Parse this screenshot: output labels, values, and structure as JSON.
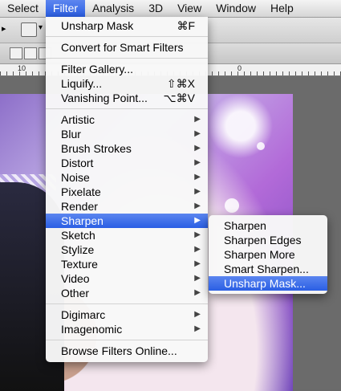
{
  "menubar": {
    "items": [
      {
        "label": "Select",
        "active": false
      },
      {
        "label": "Filter",
        "active": true
      },
      {
        "label": "Analysis",
        "active": false
      },
      {
        "label": "3D",
        "active": false
      },
      {
        "label": "View",
        "active": false
      },
      {
        "label": "Window",
        "active": false
      },
      {
        "label": "Help",
        "active": false
      }
    ]
  },
  "ruler": {
    "labels": [
      "10",
      "0"
    ]
  },
  "filter_menu": {
    "unsharp_mask": {
      "label": "Unsharp Mask",
      "shortcut": "⌘F"
    },
    "convert_smart": "Convert for Smart Filters",
    "filter_gallery": "Filter Gallery...",
    "liquify": {
      "label": "Liquify...",
      "shortcut": "⇧⌘X"
    },
    "vanishing_point": {
      "label": "Vanishing Point...",
      "shortcut": "⌥⌘V"
    },
    "submenus": [
      "Artistic",
      "Blur",
      "Brush Strokes",
      "Distort",
      "Noise",
      "Pixelate",
      "Render",
      "Sharpen",
      "Sketch",
      "Stylize",
      "Texture",
      "Video",
      "Other"
    ],
    "plugins": [
      "Digimarc",
      "Imagenomic"
    ],
    "browse_online": "Browse Filters Online..."
  },
  "sharpen_menu": {
    "items": [
      "Sharpen",
      "Sharpen Edges",
      "Sharpen More",
      "Smart Sharpen...",
      "Unsharp Mask..."
    ],
    "highlighted": "Unsharp Mask..."
  }
}
